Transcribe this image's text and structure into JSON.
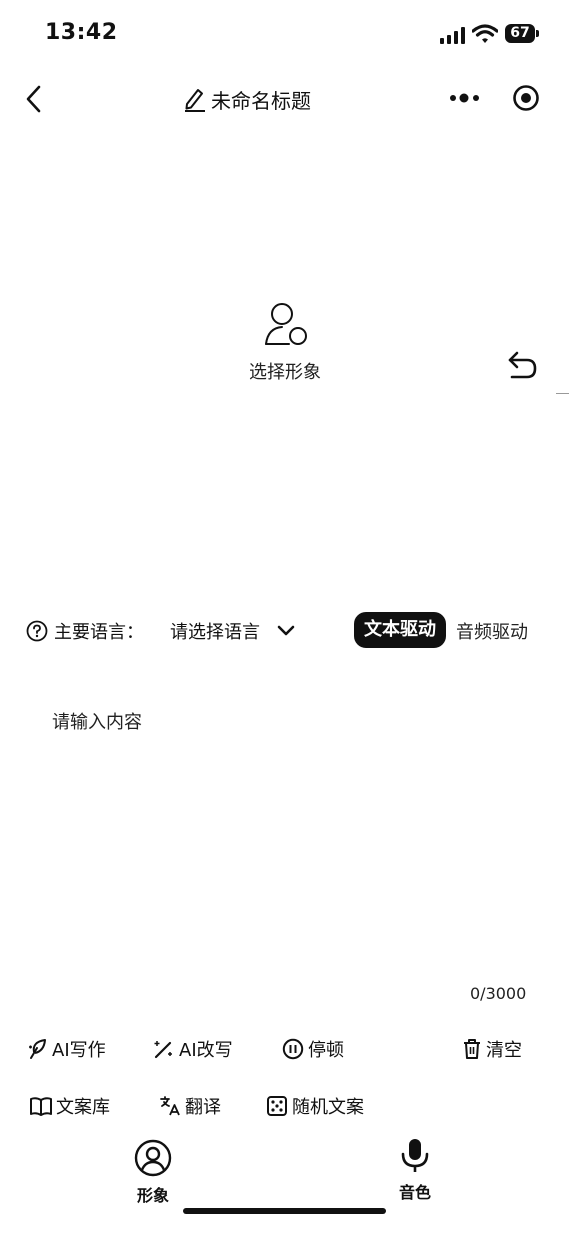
{
  "status_bar": {
    "time": "13:42",
    "battery": "67"
  },
  "header": {
    "title": "未命名标题"
  },
  "avatar": {
    "label": "选择形象"
  },
  "language": {
    "label": "主要语言：",
    "selected": "请选择语言"
  },
  "drive_mode": {
    "active": "文本驱动",
    "inactive": "音频驱动"
  },
  "editor": {
    "placeholder": "请输入内容",
    "value": "",
    "counter": "0/3000"
  },
  "tools": {
    "ai_write": "AI写作",
    "ai_rewrite": "AI改写",
    "pause": "停顿",
    "clear": "清空",
    "library": "文案库",
    "translate": "翻译",
    "random": "随机文案"
  },
  "bottom_nav": {
    "avatar": "形象",
    "voice": "音色"
  },
  "colors": {
    "foreground": "#111111",
    "background": "#ffffff"
  }
}
